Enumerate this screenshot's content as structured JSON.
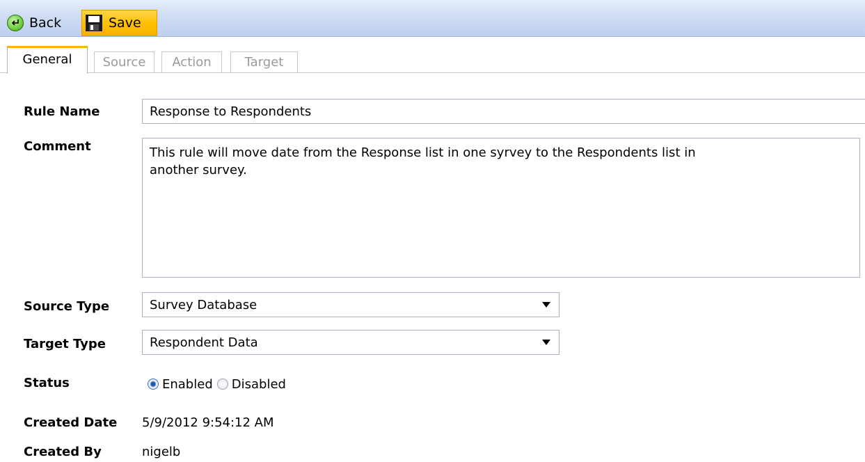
{
  "toolbar": {
    "back_label": "Back",
    "save_label": "Save"
  },
  "tabs": [
    {
      "label": "General",
      "active": true
    },
    {
      "label": "Source",
      "active": false
    },
    {
      "label": "Action",
      "active": false
    },
    {
      "label": "Target",
      "active": false
    }
  ],
  "form": {
    "rule_name": {
      "label": "Rule Name",
      "value": "Response to Respondents"
    },
    "comment": {
      "label": "Comment",
      "value": "This rule will move date from the Response list in one syrvey to the Respondents list in\nanother survey."
    },
    "source_type": {
      "label": "Source Type",
      "selected": "Survey Database"
    },
    "target_type": {
      "label": "Target Type",
      "selected": "Respondent Data"
    },
    "status": {
      "label": "Status",
      "options": [
        {
          "label": "Enabled",
          "checked": true
        },
        {
          "label": "Disabled",
          "checked": false
        }
      ]
    },
    "created_date": {
      "label": "Created Date",
      "value": "5/9/2012 9:54:12 AM"
    },
    "created_by": {
      "label": "Created By",
      "value": "nigelb"
    }
  },
  "colors": {
    "toolbar_bg": "#cfdcf3",
    "save_highlight": "#ffc000",
    "active_tab_accent": "#ffb400",
    "inactive_tab_text": "#9a9a9a"
  }
}
